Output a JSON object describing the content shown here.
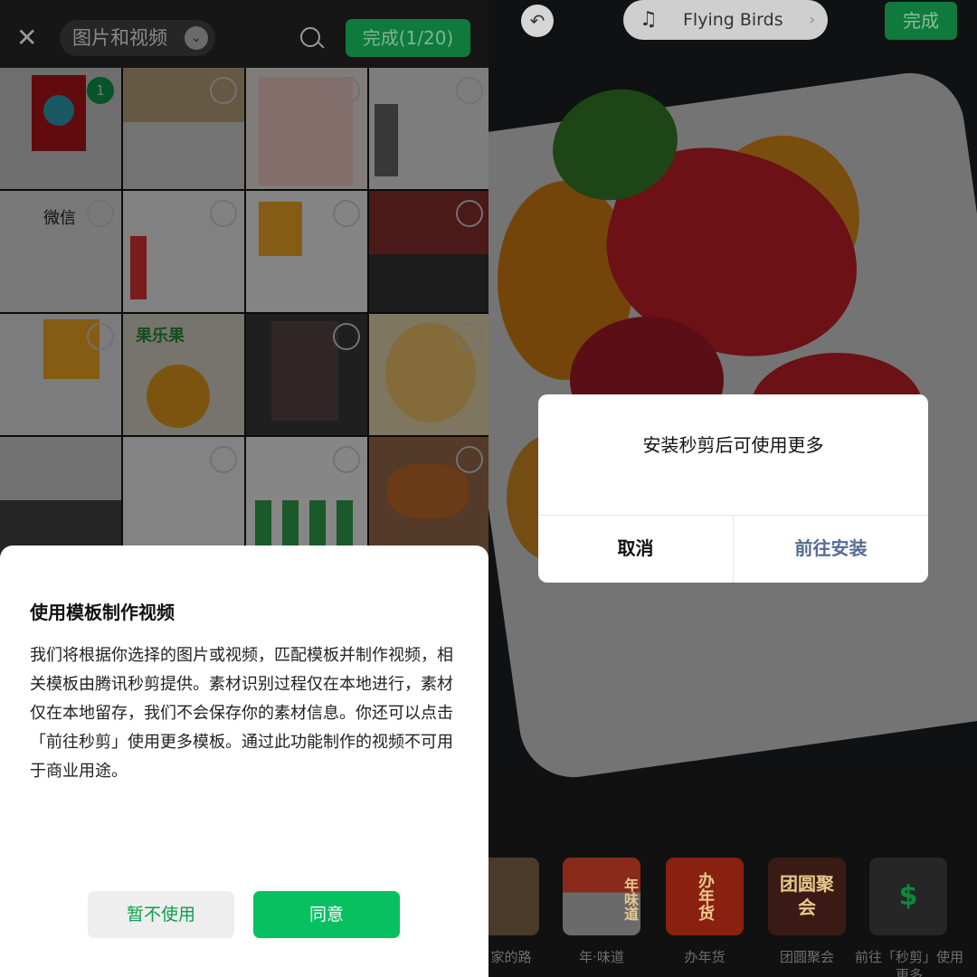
{
  "picker": {
    "close_icon": "close-icon",
    "album_label": "图片和视频",
    "search_icon": "search-icon",
    "done_label": "完成(1/20)",
    "selected_index": "1",
    "thumb_texts": {
      "wechat": "微信",
      "snack": "果乐果"
    }
  },
  "sheet": {
    "title": "使用模板制作视频",
    "body": "我们将根据你选择的图片或视频，匹配模板并制作视频，相关模板由腾讯秒剪提供。素材识别过程仅在本地进行，素材仅在本地留存，我们不会保存你的素材信息。你还可以点击「前往秒剪」使用更多模板。通过此功能制作的视频不可用于商业用途。",
    "decline_label": "暂不使用",
    "agree_label": "同意"
  },
  "editor": {
    "undo_icon": "undo-icon",
    "music_title": "Flying Birds",
    "done_label": "完成",
    "dialog": {
      "message": "安装秒剪后可使用更多",
      "cancel_label": "取消",
      "confirm_label": "前往安装"
    },
    "templates": [
      {
        "label": "家的路"
      },
      {
        "label": "年·味道",
        "art": "年味道"
      },
      {
        "label": "办年货",
        "art": "办年货"
      },
      {
        "label": "团圆聚会",
        "art": "团圆聚会"
      },
      {
        "label": "前往「秒剪」使用更多"
      }
    ]
  },
  "colors": {
    "accent": "#07c160",
    "link": "#576b95"
  }
}
